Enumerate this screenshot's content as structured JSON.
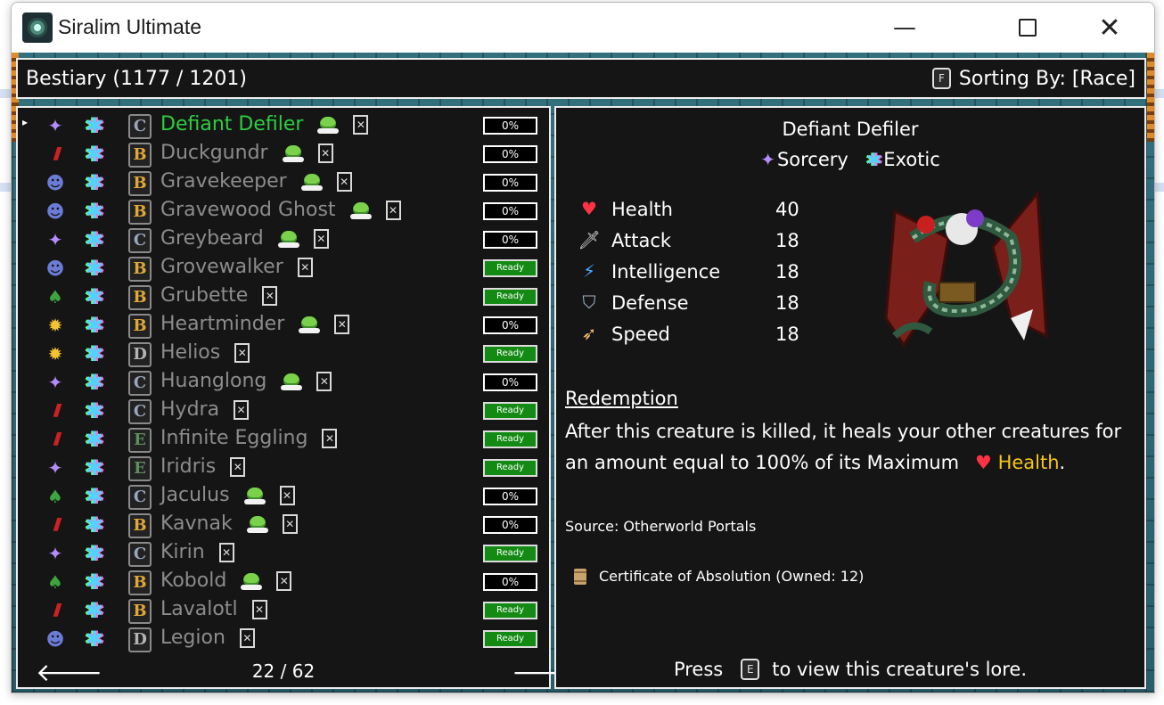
{
  "window": {
    "title": "Siralim Ultimate"
  },
  "header": {
    "title": "Bestiary (1177 / 1201)",
    "sort_key": "F",
    "sort_label": "Sorting By: [Race]"
  },
  "list": {
    "rows": [
      {
        "race": "sorcery",
        "rarity": "C",
        "name": "Defiant Defiler",
        "goblin": true,
        "progress": "0%",
        "ready": false,
        "selected": true
      },
      {
        "race": "cretan",
        "rarity": "B",
        "name": "Duckgundr",
        "goblin": true,
        "progress": "0%",
        "ready": false
      },
      {
        "race": "death",
        "rarity": "B",
        "name": "Gravekeeper",
        "goblin": true,
        "progress": "0%",
        "ready": false
      },
      {
        "race": "death",
        "rarity": "B",
        "name": "Gravewood Ghost",
        "goblin": true,
        "progress": "0%",
        "ready": false
      },
      {
        "race": "sorcery",
        "rarity": "C",
        "name": "Greybeard",
        "goblin": true,
        "progress": "0%",
        "ready": false
      },
      {
        "race": "death",
        "rarity": "B",
        "name": "Grovewalker",
        "goblin": false,
        "progress": "Ready",
        "ready": true
      },
      {
        "race": "nature",
        "rarity": "B",
        "name": "Grubette",
        "goblin": false,
        "progress": "Ready",
        "ready": true
      },
      {
        "race": "life",
        "rarity": "B",
        "name": "Heartminder",
        "goblin": true,
        "progress": "0%",
        "ready": false
      },
      {
        "race": "life",
        "rarity": "D",
        "name": "Helios",
        "goblin": false,
        "progress": "Ready",
        "ready": true
      },
      {
        "race": "sorcery",
        "rarity": "C",
        "name": "Huanglong",
        "goblin": true,
        "progress": "0%",
        "ready": false
      },
      {
        "race": "cretan",
        "rarity": "C",
        "name": "Hydra",
        "goblin": false,
        "progress": "Ready",
        "ready": true
      },
      {
        "race": "cretan",
        "rarity": "E",
        "name": "Infinite Eggling",
        "goblin": false,
        "progress": "Ready",
        "ready": true
      },
      {
        "race": "sorcery",
        "rarity": "E",
        "name": "Iridris",
        "goblin": false,
        "progress": "Ready",
        "ready": true
      },
      {
        "race": "nature",
        "rarity": "C",
        "name": "Jaculus",
        "goblin": true,
        "progress": "0%",
        "ready": false
      },
      {
        "race": "cretan",
        "rarity": "B",
        "name": "Kavnak",
        "goblin": true,
        "progress": "0%",
        "ready": false
      },
      {
        "race": "sorcery",
        "rarity": "C",
        "name": "Kirin",
        "goblin": false,
        "progress": "Ready",
        "ready": true
      },
      {
        "race": "nature",
        "rarity": "B",
        "name": "Kobold",
        "goblin": true,
        "progress": "0%",
        "ready": false
      },
      {
        "race": "cretan",
        "rarity": "B",
        "name": "Lavalotl",
        "goblin": false,
        "progress": "Ready",
        "ready": true
      },
      {
        "race": "death",
        "rarity": "D",
        "name": "Legion",
        "goblin": false,
        "progress": "Ready",
        "ready": true
      }
    ],
    "page": "22 / 62"
  },
  "detail": {
    "name": "Defiant Defiler",
    "race": "Sorcery",
    "class": "Exotic",
    "stats": [
      {
        "icon": "heart-icon",
        "label": "Health",
        "value": "40"
      },
      {
        "icon": "sword-icon",
        "label": "Attack",
        "value": "18"
      },
      {
        "icon": "lightning-icon",
        "label": "Intelligence",
        "value": "18"
      },
      {
        "icon": "shield-icon",
        "label": "Defense",
        "value": "18"
      },
      {
        "icon": "wing-icon",
        "label": "Speed",
        "value": "18"
      }
    ],
    "trait_name": "Redemption",
    "trait_desc_1": "After this creature is killed, it heals your other creatures for an amount equal to 100% of its Maximum",
    "trait_desc_highlight": "Health",
    "trait_desc_end": ".",
    "source": "Source: Otherworld Portals",
    "certificate": "Certificate of Absolution (Owned: 12)",
    "lore_press": "Press",
    "lore_key": "E",
    "lore_rest": "to view this creature's lore."
  },
  "icons": {
    "race_glyphs": {
      "sorcery": "✦",
      "cretan": "///",
      "death": "☻",
      "nature": "♠",
      "life": "✹"
    },
    "class_glyph": "✱",
    "colors": {
      "selected": "#2ecc40",
      "ready": "#138a13",
      "highlight": "#f5c518"
    }
  }
}
